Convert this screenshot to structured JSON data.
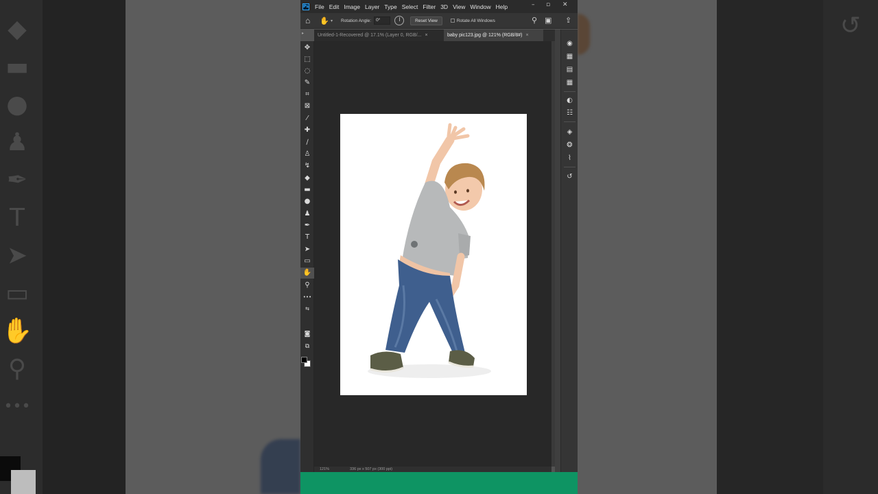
{
  "app": {
    "name": "Adobe Photoshop",
    "logo_text": "Ps"
  },
  "menu": {
    "items": [
      "File",
      "Edit",
      "Image",
      "Layer",
      "Type",
      "Select",
      "Filter",
      "3D",
      "View",
      "Window",
      "Help"
    ]
  },
  "window_controls": {
    "minimize": "–",
    "maximize": "▫",
    "close": "✕"
  },
  "options_bar": {
    "rotation_angle_label": "Rotation Angle:",
    "rotation_angle_value": "0°",
    "reset_view_label": "Reset View",
    "rotate_all_windows_label": "Rotate All Windows",
    "rotate_all_windows_checked": false
  },
  "tabs": [
    {
      "label": "Untitled-1-Recovered @ 17.1% (Layer 0, RGB/...",
      "close": "×",
      "active": false
    },
    {
      "label": "baby pic123.jpg @ 121% (RGB/8#)",
      "close": "×",
      "active": true
    }
  ],
  "status": {
    "zoom": "121%",
    "dimensions": "336 px x 507 px (300 ppi)"
  },
  "tools": [
    {
      "name": "move-tool-icon",
      "glyph": "✥"
    },
    {
      "name": "marquee-tool-icon",
      "glyph": "⬚"
    },
    {
      "name": "lasso-tool-icon",
      "glyph": "◌"
    },
    {
      "name": "quick-selection-tool-icon",
      "glyph": "✎"
    },
    {
      "name": "crop-tool-icon",
      "glyph": "⌗"
    },
    {
      "name": "frame-tool-icon",
      "glyph": "⊠"
    },
    {
      "name": "eyedropper-tool-icon",
      "glyph": "⁄"
    },
    {
      "name": "healing-brush-tool-icon",
      "glyph": "✚"
    },
    {
      "name": "brush-tool-icon",
      "glyph": "∕"
    },
    {
      "name": "clone-stamp-tool-icon",
      "glyph": "♙"
    },
    {
      "name": "history-brush-tool-icon",
      "glyph": "↯"
    },
    {
      "name": "eraser-tool-icon",
      "glyph": "◆"
    },
    {
      "name": "gradient-tool-icon",
      "glyph": "▬"
    },
    {
      "name": "blur-tool-icon",
      "glyph": "●"
    },
    {
      "name": "dodge-tool-icon",
      "glyph": "♟"
    },
    {
      "name": "pen-tool-icon",
      "glyph": "✒"
    },
    {
      "name": "type-tool-icon",
      "glyph": "T"
    },
    {
      "name": "path-selection-tool-icon",
      "glyph": "➤"
    },
    {
      "name": "rectangle-tool-icon",
      "glyph": "▭"
    },
    {
      "name": "rotate-view-tool-icon",
      "glyph": "✋"
    },
    {
      "name": "zoom-tool-icon",
      "glyph": "⚲"
    },
    {
      "name": "edit-toolbar-icon",
      "glyph": "•••"
    }
  ],
  "panels": [
    {
      "name": "learn-panel-icon",
      "glyph": "◉"
    },
    {
      "name": "swatches-panel-icon",
      "glyph": "▦"
    },
    {
      "name": "gradients-panel-icon",
      "glyph": "▤"
    },
    {
      "name": "patterns-panel-icon",
      "glyph": "▦"
    },
    {
      "name": "adjustments-panel-icon",
      "glyph": "◐"
    },
    {
      "name": "properties-panel-icon",
      "glyph": "☷"
    },
    {
      "name": "layers-panel-icon",
      "glyph": "◈"
    },
    {
      "name": "channels-panel-icon",
      "glyph": "❂"
    },
    {
      "name": "paths-panel-icon",
      "glyph": "⌇"
    },
    {
      "name": "history-panel-icon",
      "glyph": "↺"
    }
  ],
  "colors": {
    "foreground": "#000000",
    "background": "#ffffff",
    "banner": "#0e9463"
  }
}
